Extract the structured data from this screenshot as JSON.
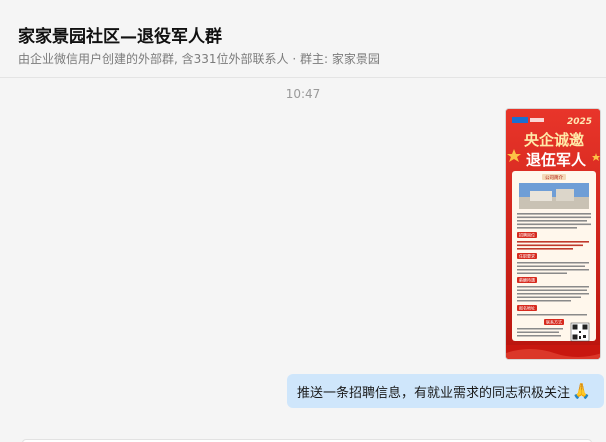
{
  "header": {
    "title": "家家景园社区—退役军人群",
    "subtitle": "由企业微信用户创建的外部群, 含331位外部联系人 · 群主: 家家景园"
  },
  "messages": {
    "timestamp": "10:47",
    "image_post": {
      "year": "2025",
      "headline_1": "央企诚邀",
      "headline_2": "退伍军人",
      "section_company": "公司简介",
      "section_positions": "招聘岗位",
      "section_requirements": "任职要求",
      "section_salary": "薪酬待遇",
      "section_address": "报名地址",
      "section_contact": "联系方式"
    },
    "text_message": "推送一条招聘信息，有就业需求的同志积极关注",
    "emoji_icon": "folded-hands-icon",
    "emoji": "🙏"
  },
  "colors": {
    "poster_red": "#d9261c",
    "bubble_blue": "#cfe6fb"
  }
}
